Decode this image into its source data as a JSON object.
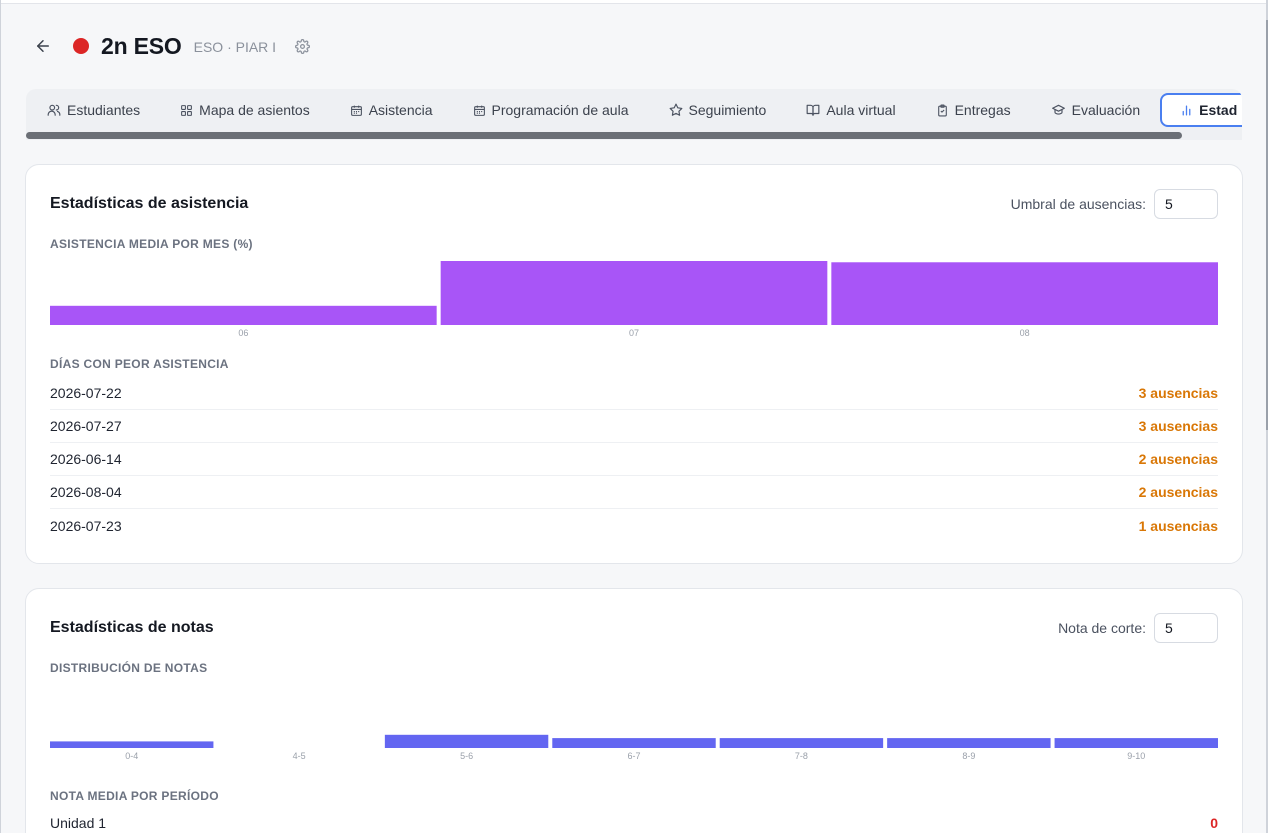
{
  "header": {
    "title": "2n ESO",
    "subtitle": "ESO · PIAR I",
    "status_color": "#dc2626",
    "icons": {
      "back": "arrow-left-icon",
      "settings": "gear-icon"
    }
  },
  "tabs": [
    {
      "label": "Estudiantes",
      "icon": "users-icon"
    },
    {
      "label": "Mapa de asientos",
      "icon": "grid-icon"
    },
    {
      "label": "Asistencia",
      "icon": "calendar-icon"
    },
    {
      "label": "Programación de aula",
      "icon": "calendar-icon"
    },
    {
      "label": "Seguimiento",
      "icon": "star-icon"
    },
    {
      "label": "Aula virtual",
      "icon": "book-open-icon"
    },
    {
      "label": "Entregas",
      "icon": "clipboard-check-icon"
    },
    {
      "label": "Evaluación",
      "icon": "graduation-cap-icon"
    },
    {
      "label": "Estad",
      "icon": "bar-chart-icon",
      "active": true
    }
  ],
  "attendance": {
    "title": "Estadísticas de asistencia",
    "threshold_label": "Umbral de ausencias:",
    "threshold_value": "5",
    "chart_label": "ASISTENCIA MEDIA POR MES (%)",
    "worst_days_label": "DÍAS CON PEOR ASISTENCIA",
    "worst_days": [
      {
        "date": "2026-07-22",
        "absences": "3 ausencias"
      },
      {
        "date": "2026-07-27",
        "absences": "3 ausencias"
      },
      {
        "date": "2026-06-14",
        "absences": "2 ausencias"
      },
      {
        "date": "2026-08-04",
        "absences": "2 ausencias"
      },
      {
        "date": "2026-07-23",
        "absences": "1 ausencias"
      }
    ]
  },
  "grades": {
    "title": "Estadísticas de notas",
    "threshold_label": "Nota de corte:",
    "threshold_value": "5",
    "chart_label": "DISTRIBUCIÓN DE NOTAS",
    "period_label": "NOTA MEDIA POR PERÍODO",
    "periods": [
      {
        "name": "Unidad 1",
        "value": "0"
      }
    ]
  },
  "colors": {
    "attendance_bar": "#a855f7",
    "grades_bar": "#6366f1",
    "absence_text": "#d97706",
    "accent": "#4a7ff0"
  },
  "chart_data": [
    {
      "type": "bar",
      "title": "ASISTENCIA MEDIA POR MES (%)",
      "categories": [
        "06",
        "07",
        "08"
      ],
      "values": [
        30,
        100,
        98
      ],
      "ylim": [
        0,
        100
      ],
      "grid": false
    },
    {
      "type": "bar",
      "title": "DISTRIBUCIÓN DE NOTAS",
      "categories": [
        "0-4",
        "4-5",
        "5-6",
        "6-7",
        "7-8",
        "8-9",
        "9-10"
      ],
      "values": [
        1,
        0,
        2,
        1.5,
        1.5,
        1.5,
        1.5
      ],
      "ylim": [
        0,
        10
      ],
      "grid": false
    }
  ]
}
